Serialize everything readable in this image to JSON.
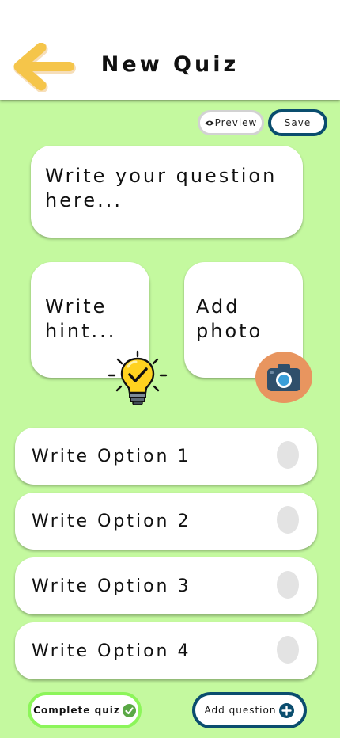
{
  "header": {
    "title": "New Quiz",
    "back_icon": "arrow-left-icon"
  },
  "toolbar": {
    "preview_label": "Preview",
    "preview_icon": "eye-icon",
    "save_label": "Save"
  },
  "question": {
    "placeholder": "Write your question here..."
  },
  "hint": {
    "placeholder": "Write hint...",
    "icon": "lightbulb-check-icon"
  },
  "photo": {
    "label": "Add photo",
    "icon": "camera-icon"
  },
  "options": [
    {
      "placeholder": "Write Option 1",
      "selected": false
    },
    {
      "placeholder": "Write Option 2",
      "selected": false
    },
    {
      "placeholder": "Write Option 3",
      "selected": false
    },
    {
      "placeholder": "Write Option 4",
      "selected": false
    }
  ],
  "footer": {
    "complete_label": "Complete quiz",
    "complete_icon": "check-circle-icon",
    "add_label": "Add question",
    "add_icon": "plus-circle-icon"
  },
  "colors": {
    "background": "#c4f99f",
    "arrow": "#f5c54a",
    "save_border": "#0a4d6e",
    "complete_border": "#8cf55a",
    "camera_bg": "#e8955f",
    "bulb": "#ffd21f"
  }
}
